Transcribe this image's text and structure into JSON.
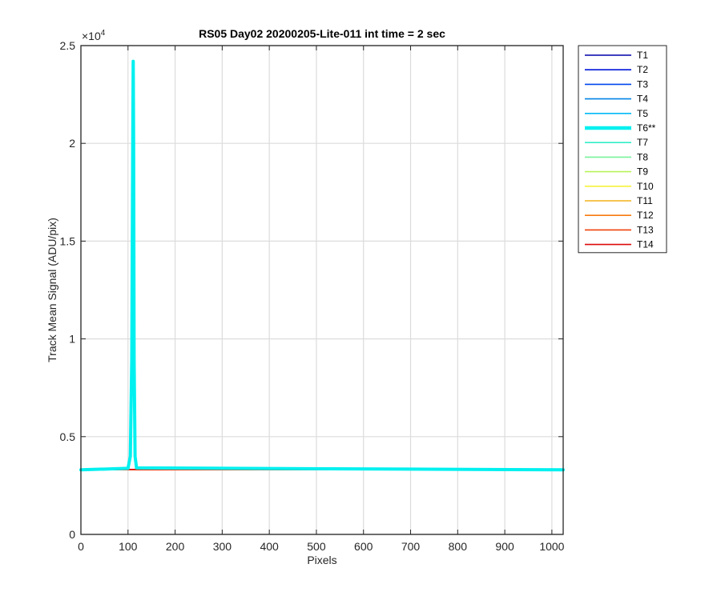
{
  "chart_data": {
    "type": "line",
    "title": "RS05 Day02 20200205-Lite-011 int time = 2 sec",
    "xlabel": "Pixels",
    "ylabel": "Track Mean Signal (ADU/pix)",
    "y_exponent_label": "×10",
    "y_exponent_power": "4",
    "xlim": [
      0,
      1024
    ],
    "ylim": [
      0,
      25000
    ],
    "x_ticks": [
      0,
      100,
      200,
      300,
      400,
      500,
      600,
      700,
      800,
      900,
      1000
    ],
    "x_tick_labels": [
      "0",
      "100",
      "200",
      "300",
      "400",
      "500",
      "600",
      "700",
      "800",
      "900",
      "1000"
    ],
    "y_ticks": [
      0,
      5000,
      10000,
      15000,
      20000,
      25000
    ],
    "y_tick_labels": [
      "0",
      "0.5",
      "1",
      "1.5",
      "2",
      "2.5"
    ],
    "grid": true,
    "legend_position": "outside-right-top",
    "series": [
      {
        "name": "T1",
        "color": "#0000aa",
        "highlight": false,
        "x": [
          0,
          1024
        ],
        "y": [
          3300,
          3300
        ]
      },
      {
        "name": "T2",
        "color": "#0016d9",
        "highlight": false,
        "x": [
          0,
          1024
        ],
        "y": [
          3300,
          3300
        ]
      },
      {
        "name": "T3",
        "color": "#0046ee",
        "highlight": false,
        "x": [
          0,
          1024
        ],
        "y": [
          3300,
          3300
        ]
      },
      {
        "name": "T4",
        "color": "#0084e6",
        "highlight": false,
        "x": [
          0,
          1024
        ],
        "y": [
          3300,
          3300
        ]
      },
      {
        "name": "T5",
        "color": "#00baf5",
        "highlight": false,
        "x": [
          0,
          1024
        ],
        "y": [
          3300,
          3300
        ]
      },
      {
        "name": "T6**",
        "color": "#00f0f0",
        "highlight": true,
        "x": [
          0,
          100,
          105,
          108,
          110,
          111,
          112,
          113,
          115,
          118,
          1024
        ],
        "y": [
          3300,
          3380,
          4000,
          9000,
          20000,
          24200,
          20000,
          9000,
          4000,
          3400,
          3300
        ]
      },
      {
        "name": "T7",
        "color": "#33eec8",
        "highlight": false,
        "x": [
          0,
          1024
        ],
        "y": [
          3300,
          3300
        ]
      },
      {
        "name": "T8",
        "color": "#77f39a",
        "highlight": false,
        "x": [
          0,
          1024
        ],
        "y": [
          3300,
          3300
        ]
      },
      {
        "name": "T9",
        "color": "#b7f45a",
        "highlight": false,
        "x": [
          0,
          1024
        ],
        "y": [
          3300,
          3300
        ]
      },
      {
        "name": "T10",
        "color": "#f7f23a",
        "highlight": false,
        "x": [
          0,
          1024
        ],
        "y": [
          3300,
          3300
        ]
      },
      {
        "name": "T11",
        "color": "#f2b21a",
        "highlight": false,
        "x": [
          0,
          1024
        ],
        "y": [
          3300,
          3300
        ]
      },
      {
        "name": "T12",
        "color": "#f77a0e",
        "highlight": false,
        "x": [
          0,
          1024
        ],
        "y": [
          3300,
          3300
        ]
      },
      {
        "name": "T13",
        "color": "#f0420a",
        "highlight": false,
        "x": [
          0,
          1024
        ],
        "y": [
          3300,
          3300
        ]
      },
      {
        "name": "T14",
        "color": "#dd0a0a",
        "highlight": false,
        "x": [
          0,
          1024
        ],
        "y": [
          3330,
          3330
        ]
      }
    ]
  }
}
